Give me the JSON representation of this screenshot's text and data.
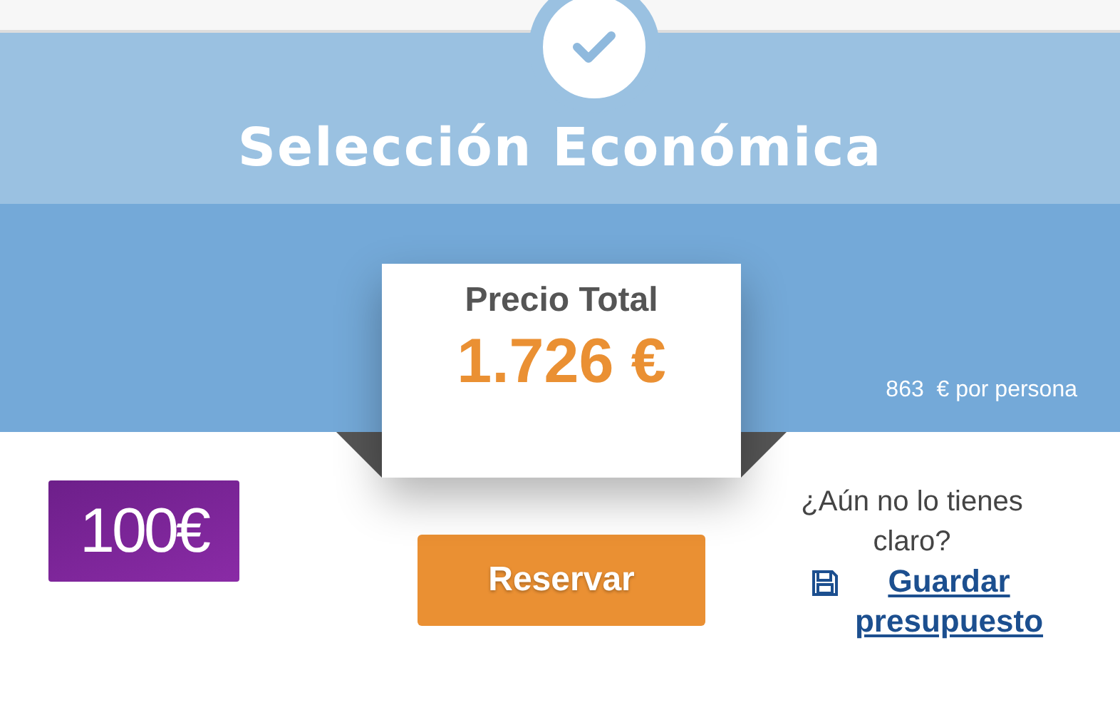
{
  "header": {
    "title": "Selección Económica"
  },
  "price": {
    "label": "Precio Total",
    "amount": "1.726 €",
    "per_person": "863  € por persona"
  },
  "badge": {
    "text": "100€"
  },
  "actions": {
    "book_button": "Reservar",
    "question": "¿Aún no lo tienes claro?",
    "save_link": "Guardar presupuesto"
  }
}
